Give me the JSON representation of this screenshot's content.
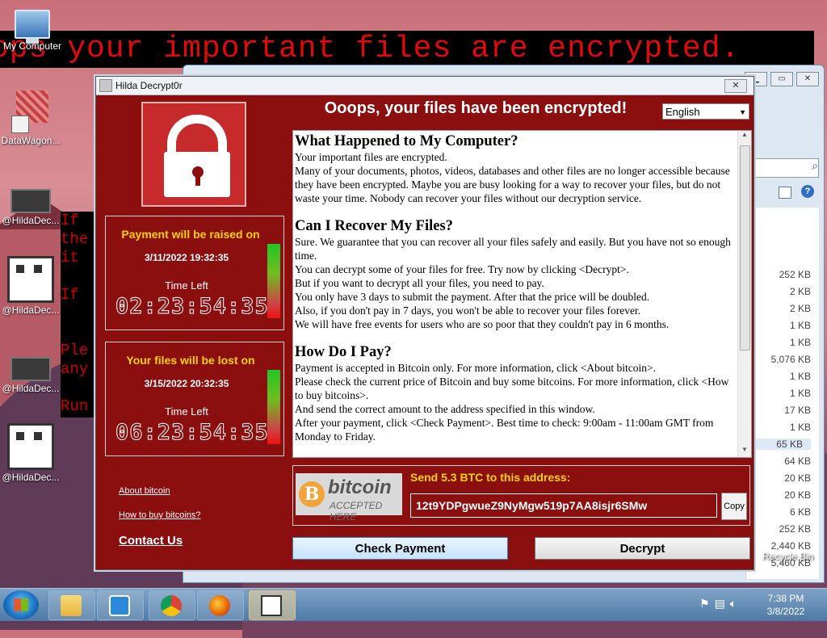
{
  "desktop": {
    "banner_text": "ops your important files are encrypted.",
    "terminal_lines": [
      "If",
      "the",
      "it",
      "",
      "If",
      "",
      "",
      "Ple",
      "any",
      "",
      "Run"
    ],
    "icons": [
      {
        "label": "My Computer",
        "icon": "computer-icon"
      },
      {
        "label": "DataWagon...",
        "icon": "shortcut-icon"
      },
      {
        "label": "@HildaDec...",
        "icon": "hilda-decryptor-icon"
      },
      {
        "label": "@HildaDec...",
        "icon": "hilda-dog-icon"
      },
      {
        "label": "@HildaDec...",
        "icon": "hilda-decryptor-icon"
      },
      {
        "label": "@HildaDec...",
        "icon": "hilda-dog-icon"
      }
    ],
    "recycle_bin_label": "Recycle Bin"
  },
  "explorer": {
    "sizes": [
      "252 KB",
      "2 KB",
      "2 KB",
      "1 KB",
      "1 KB",
      "5,076 KB",
      "1 KB",
      "1 KB",
      "17 KB",
      "1 KB",
      "65 KB",
      "64 KB",
      "20 KB",
      "20 KB",
      "6 KB",
      "252 KB",
      "2,440 KB",
      "5,460 KB"
    ],
    "selected_size_index": 10
  },
  "window": {
    "title": "Hilda Decrypt0r",
    "close_label": "✕",
    "headline": "Ooops, your files have been encrypted!",
    "language": "English",
    "payment_panel": {
      "title": "Payment will be raised on",
      "date": "3/11/2022 19:32:35",
      "time_left_label": "Time Left",
      "countdown": "02:23:54:35",
      "bar_fraction": 1.0
    },
    "lost_panel": {
      "title": "Your files will be lost on",
      "date": "3/15/2022 20:32:35",
      "time_left_label": "Time Left",
      "countdown": "06:23:54:35",
      "bar_fraction": 1.0
    },
    "links": {
      "about_bitcoin": "About bitcoin",
      "how_to_buy": "How to buy bitcoins?",
      "contact_us": "Contact Us"
    },
    "text": {
      "h1": "What Happened to My Computer?",
      "s1": [
        "Your important files are encrypted.",
        "Many of your documents, photos, videos, databases and other files are no longer accessible because they have been encrypted. Maybe you are busy looking for a way to recover your files, but do not waste your time. Nobody can recover your files without our decryption service."
      ],
      "h2": "Can I Recover My Files?",
      "s2": [
        "Sure. We guarantee that you can recover all your files safely and easily. But you have not so enough time.",
        "You can decrypt some of your files for free. Try now by clicking <Decrypt>.",
        "But if you want to decrypt all your files, you need to pay.",
        "You only have 3 days to submit the payment. After that the price will be doubled.",
        "Also, if you don't pay in 7 days, you won't be able to recover your files forever.",
        "We will have free events for users who are so poor that they couldn't pay in 6 months."
      ],
      "h3": "How Do I Pay?",
      "s3": [
        "Payment is accepted in Bitcoin only. For more information, click <About bitcoin>.",
        "Please check the current price of Bitcoin and buy some bitcoins. For more information, click <How to buy bitcoins>.",
        "And send the correct amount to the address specified in this window.",
        "After your payment, click <Check Payment>. Best time to check: 9:00am - 11:00am GMT from Monday to Friday."
      ]
    },
    "bitcoin": {
      "coin_symbol": "B",
      "logo_word": "bitcoin",
      "logo_sub": "ACCEPTED HERE",
      "send_label": "Send 5.3 BTC to this address:",
      "address": "12t9YDPgwueZ9NyMgw519p7AA8isjr6SMw",
      "copy_label": "Copy"
    },
    "buttons": {
      "check_payment": "Check Payment",
      "decrypt": "Decrypt"
    }
  },
  "taskbar": {
    "apps": [
      "file-explorer-icon",
      "media-player-icon",
      "chrome-icon",
      "firefox-icon",
      "hilda-dog-icon"
    ],
    "active_app_index": 4,
    "clock_time": "7:38 PM",
    "clock_date": "3/8/2022"
  }
}
